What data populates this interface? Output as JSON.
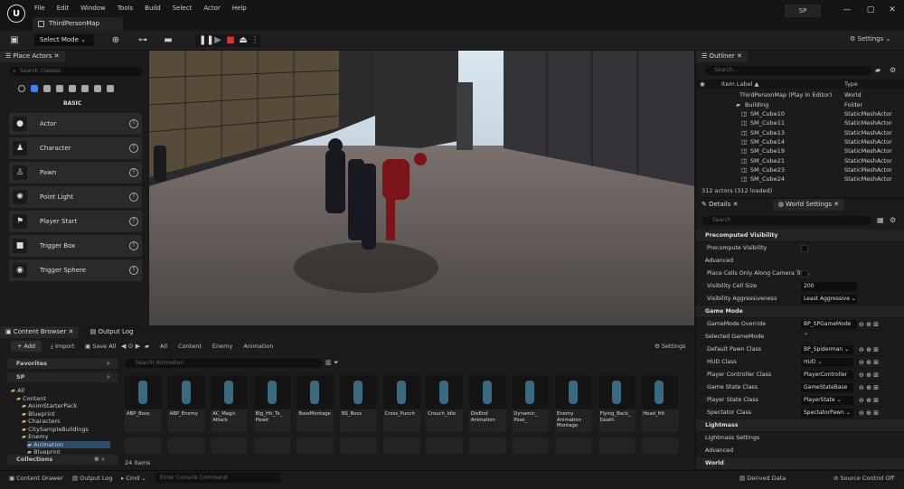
{
  "app": {
    "logo": "U",
    "map_tab": "ThirdPersonMap",
    "profile": "SP"
  },
  "menu": [
    "File",
    "Edit",
    "Window",
    "Tools",
    "Build",
    "Select",
    "Actor",
    "Help"
  ],
  "window_controls": [
    "—",
    "▢",
    "✕"
  ],
  "toolbar": {
    "select_mode": "Select Mode",
    "settings": "Settings"
  },
  "place_actors": {
    "tab": "Place Actors",
    "search_placeholder": "Search Classes",
    "category": "BASIC",
    "items": [
      "Actor",
      "Character",
      "Pawn",
      "Point Light",
      "Player Start",
      "Trigger Box",
      "Trigger Sphere"
    ]
  },
  "outliner": {
    "tab": "Outliner",
    "search_placeholder": "Search...",
    "col_label": "Item Label ▲",
    "col_type": "Type",
    "rows": [
      {
        "name": "ThirdPersonMap (Play In Editor)",
        "type": "World"
      },
      {
        "name": "Building",
        "type": "Folder"
      },
      {
        "name": "SM_Cube10",
        "type": "StaticMeshActor"
      },
      {
        "name": "SM_Cube11",
        "type": "StaticMeshActor"
      },
      {
        "name": "SM_Cube13",
        "type": "StaticMeshActor"
      },
      {
        "name": "SM_Cube14",
        "type": "StaticMeshActor"
      },
      {
        "name": "SM_Cube19",
        "type": "StaticMeshActor"
      },
      {
        "name": "SM_Cube21",
        "type": "StaticMeshActor"
      },
      {
        "name": "SM_Cube23",
        "type": "StaticMeshActor"
      },
      {
        "name": "SM_Cube24",
        "type": "StaticMeshActor"
      }
    ],
    "count": "312 actors (312 loaded)"
  },
  "details": {
    "tab1": "Details",
    "tab2": "World Settings",
    "search_placeholder": "Search",
    "rows": [
      {
        "kind": "sec",
        "label": "Precomputed Visibility"
      },
      {
        "kind": "chk",
        "label": "Precompute Visibility"
      },
      {
        "kind": "sub",
        "label": "Advanced"
      },
      {
        "kind": "chk",
        "label": "Place Cells Only Along Camera Tra..."
      },
      {
        "kind": "val",
        "label": "Visibility Cell Size",
        "value": "200"
      },
      {
        "kind": "val",
        "label": "Visibility Aggressiveness",
        "value": "Least Aggressive ⌄"
      },
      {
        "kind": "sec",
        "label": "Game Mode"
      },
      {
        "kind": "val",
        "label": "GameMode Override",
        "value": "BP_SPGameMode ⌄"
      },
      {
        "kind": "sub",
        "label": "Selected GameMode"
      },
      {
        "kind": "val2",
        "label": "Default Pawn Class",
        "value": "BP_Spiderman ⌄"
      },
      {
        "kind": "val2",
        "label": "HUD Class",
        "value": "HUD ⌄"
      },
      {
        "kind": "val2",
        "label": "Player Controller Class",
        "value": "PlayerController ⌄"
      },
      {
        "kind": "val2",
        "label": "Game State Class",
        "value": "GameStateBase ⌄"
      },
      {
        "kind": "val2",
        "label": "Player State Class",
        "value": "PlayerState ⌄"
      },
      {
        "kind": "val2",
        "label": "Spectator Class",
        "value": "SpectatorPawn ⌄"
      },
      {
        "kind": "sec",
        "label": "Lightmass"
      },
      {
        "kind": "sub",
        "label": "Lightmass Settings"
      },
      {
        "kind": "sub",
        "label": "Advanced"
      },
      {
        "kind": "sec",
        "label": "World"
      }
    ]
  },
  "content_browser": {
    "tab1": "Content Browser",
    "tab2": "Output Log",
    "add": "+ Add",
    "import": "Import",
    "save_all": "Save All",
    "breadcrumb": [
      "All",
      "Content",
      "Enemy",
      "Animation"
    ],
    "settings": "Settings",
    "favorites": "Favorites",
    "project": "SP",
    "search_placeholder": "Search Animation",
    "tree": [
      {
        "label": "All",
        "indent": 0
      },
      {
        "label": "Content",
        "indent": 1
      },
      {
        "label": "AnimStarterPack",
        "indent": 2
      },
      {
        "label": "Blueprint",
        "indent": 2
      },
      {
        "label": "Characters",
        "indent": 2
      },
      {
        "label": "CitySampleBuildings",
        "indent": 2
      },
      {
        "label": "Enemy",
        "indent": 2
      },
      {
        "label": "Animation",
        "indent": 3
      },
      {
        "label": "Blueprint",
        "indent": 3
      }
    ],
    "collections": "Collections",
    "assets": [
      "ABP_Boss",
      "ABP_Enemy",
      "AC_Magic Attack",
      "Big_Hit_To_ Head",
      "BossMontage",
      "BS_Boss",
      "Cross_Punch",
      "Crouch_Idle",
      "DieEnd Animation",
      "Dynamic_ Pose_",
      "Enemy Animation Montage",
      "Flying_Back_ Death",
      "Head_Hit"
    ],
    "items_count": "24 items"
  },
  "status": {
    "content_drawer": "Content Drawer",
    "output_log": "Output Log",
    "cmd": "Cmd ⌄",
    "console_placeholder": "Enter Console Command",
    "derived_data": "Derived Data",
    "source_control": "Source Control Off"
  }
}
